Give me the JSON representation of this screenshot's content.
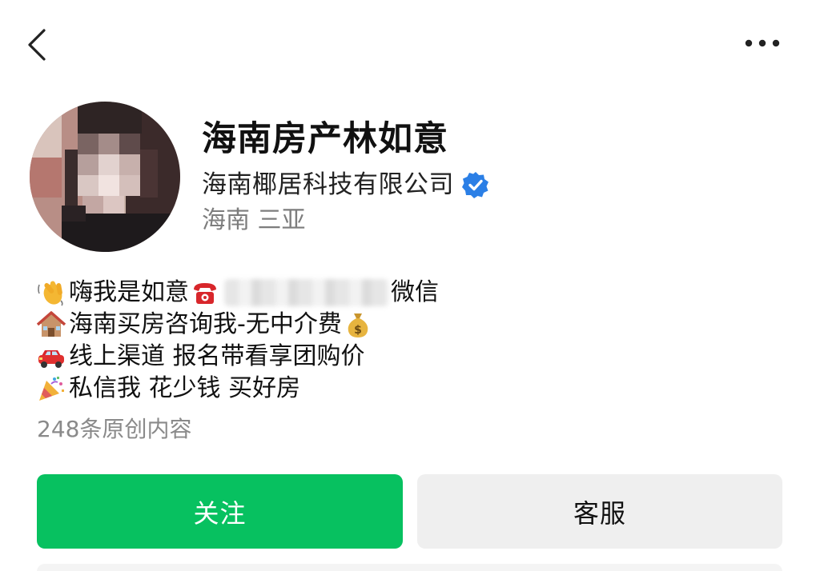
{
  "nav": {
    "back_icon": "chevron-left-icon",
    "more_icon": "ellipsis-horizontal-icon"
  },
  "profile": {
    "name": "海南房产林如意",
    "company": "海南椰居科技有限公司",
    "verified_icon": "verified-badge-icon",
    "verified_color": "#2b7fe6",
    "location": "海南 三亚"
  },
  "bio": {
    "line1_start": "嗨我是如意",
    "line1_end": "微信",
    "line2": "海南买房咨询我-无中介费",
    "line3": "线上渠道 报名带看享团购价",
    "line4": "私信我 花少钱 买好房",
    "icons": [
      "waving-hand-icon",
      "telephone-icon",
      "house-icon",
      "money-bag-icon",
      "car-icon",
      "party-popper-icon"
    ]
  },
  "stats": {
    "post_count": "248条原创内容"
  },
  "actions": {
    "follow_label": "关注",
    "service_label": "客服",
    "follow_color": "#07c160",
    "service_color": "#efefef"
  }
}
